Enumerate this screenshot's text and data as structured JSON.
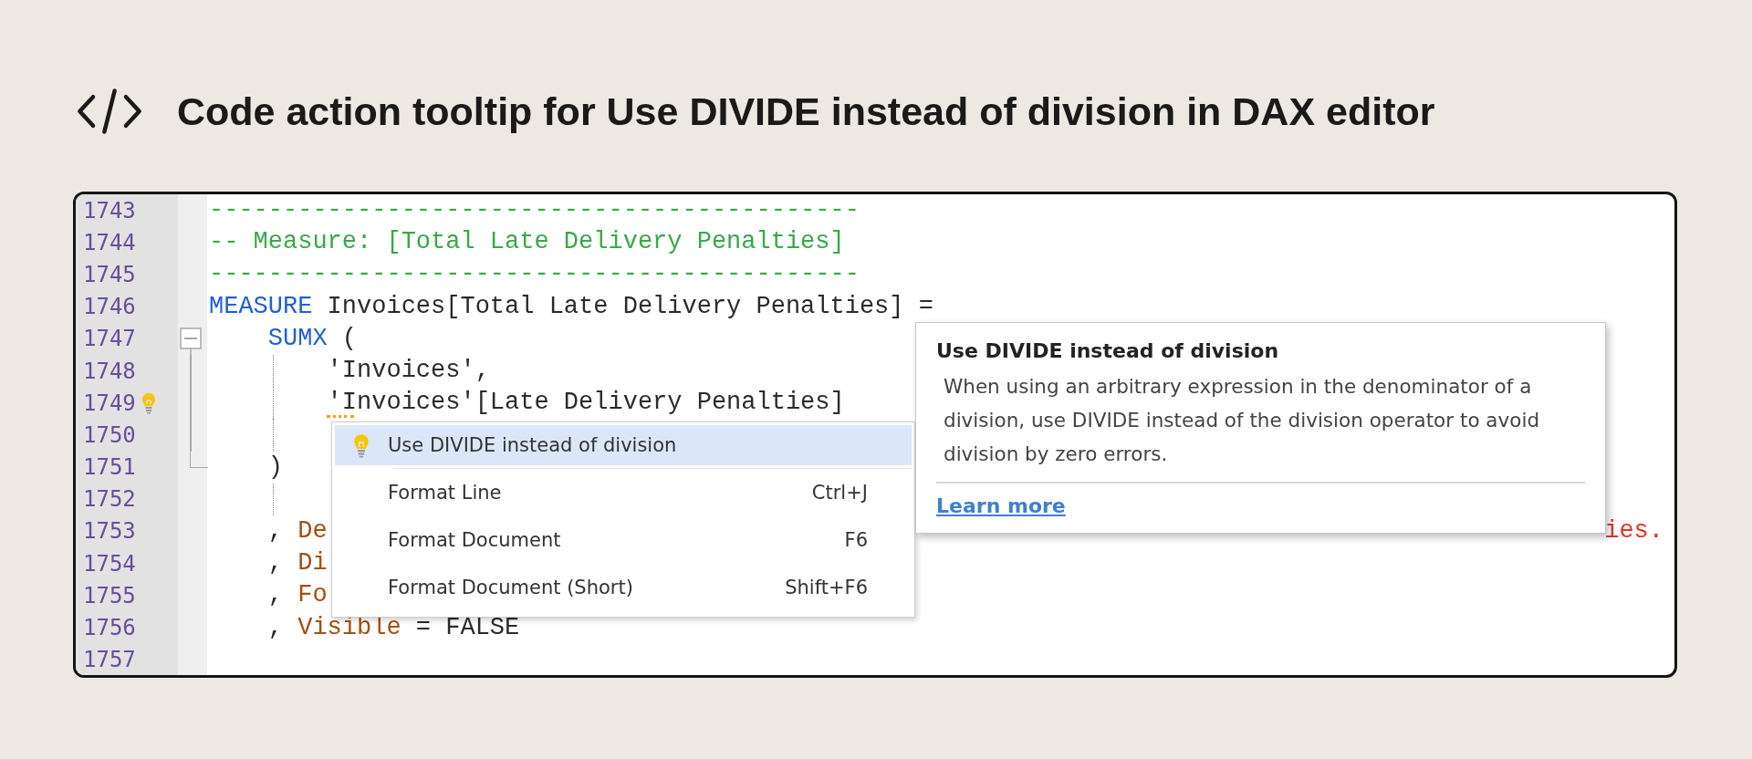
{
  "header": {
    "title": "Code action tooltip for Use DIVIDE instead of division in DAX editor"
  },
  "editor": {
    "lines": [
      {
        "number": "1743",
        "tokens": [
          {
            "text": "--------------------------------------------",
            "kind": "comment"
          }
        ]
      },
      {
        "number": "1744",
        "tokens": [
          {
            "text": "-- Measure: [Total Late Delivery Penalties]",
            "kind": "comment"
          }
        ]
      },
      {
        "number": "1745",
        "tokens": [
          {
            "text": "--------------------------------------------",
            "kind": "comment"
          }
        ]
      },
      {
        "number": "1746",
        "tokens": [
          {
            "text": "MEASURE",
            "kind": "keyword"
          },
          {
            "text": " Invoices[Total Late Delivery Penalties] =",
            "kind": "plain"
          }
        ]
      },
      {
        "number": "1747",
        "fold_start": true,
        "tokens": [
          {
            "text": "    SUMX",
            "kind": "keyword"
          },
          {
            "text": " (",
            "kind": "plain"
          }
        ]
      },
      {
        "number": "1748",
        "in_fold": true,
        "indent_guide": true,
        "tokens": [
          {
            "text": "        'Invoices',",
            "kind": "plain"
          }
        ]
      },
      {
        "number": "1749",
        "in_fold": true,
        "indent_guide": true,
        "lightbulb": true,
        "flagged": true,
        "tokens": [
          {
            "text": "        'Invoices'[Late Delivery Penalties]",
            "kind": "plain"
          }
        ]
      },
      {
        "number": "1750",
        "in_fold": true,
        "indent_guide": true
      },
      {
        "number": "1751",
        "fold_end": true,
        "tokens": [
          {
            "text": "    )",
            "kind": "plain"
          }
        ]
      },
      {
        "number": "1752",
        "indent_guide": true
      },
      {
        "number": "1753",
        "tokens": [
          {
            "text": "    , ",
            "kind": "plain"
          },
          {
            "text": "De",
            "kind": "property"
          }
        ],
        "tail": {
          "text": "ies.",
          "kind": "error"
        }
      },
      {
        "number": "1754",
        "tokens": [
          {
            "text": "    , ",
            "kind": "plain"
          },
          {
            "text": "Di",
            "kind": "property"
          }
        ]
      },
      {
        "number": "1755",
        "tokens": [
          {
            "text": "    , ",
            "kind": "plain"
          },
          {
            "text": "Fo",
            "kind": "property"
          }
        ]
      },
      {
        "number": "1756",
        "tokens": [
          {
            "text": "    , ",
            "kind": "plain"
          },
          {
            "text": "Visible",
            "kind": "property"
          },
          {
            "text": " = FALSE",
            "kind": "plain"
          }
        ]
      },
      {
        "number": "1757"
      }
    ]
  },
  "code_actions_menu": {
    "items": [
      {
        "kind": "quick-fix",
        "label": "Use DIVIDE instead of division",
        "selected": true
      },
      {
        "kind": "command",
        "label": "Format Line",
        "shortcut": "Ctrl+J",
        "selected": false
      },
      {
        "kind": "command",
        "label": "Format Document",
        "shortcut": "F6",
        "selected": false
      },
      {
        "kind": "command",
        "label": "Format Document (Short)",
        "shortcut": "Shift+F6",
        "selected": false
      }
    ]
  },
  "tooltip": {
    "title": "Use DIVIDE instead of division",
    "description": "When using an arbitrary expression in the denominator of a division, use DIVIDE instead of the division operator to avoid division by zero errors.",
    "link": "Learn more"
  }
}
